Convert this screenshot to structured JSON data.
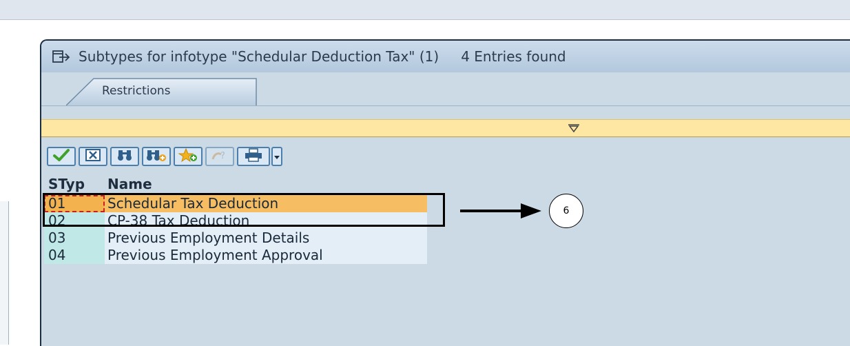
{
  "dialog": {
    "title": "Subtypes for infotype \"Schedular Deduction Tax\" (1)",
    "entries_found": "4 Entries found"
  },
  "tabs": [
    {
      "label": "Restrictions"
    }
  ],
  "toolbar": [
    {
      "icon": "checkmark-icon",
      "state": "enabled"
    },
    {
      "icon": "cancel-x-icon",
      "state": "enabled"
    },
    {
      "icon": "binoculars-icon",
      "state": "enabled"
    },
    {
      "icon": "binoculars-plus-icon",
      "state": "enabled"
    },
    {
      "icon": "star-add-icon",
      "state": "enabled"
    },
    {
      "icon": "help-icon",
      "state": "disabled"
    },
    {
      "icon": "print-icon",
      "state": "enabled"
    },
    {
      "icon": "dropdown-arrow-icon",
      "state": "enabled"
    }
  ],
  "table": {
    "headers": {
      "code": "STyp",
      "name": "Name"
    },
    "rows": [
      {
        "code": "01",
        "name": "Schedular Tax Deduction",
        "selected": true
      },
      {
        "code": "02",
        "name": "CP-38 Tax Deduction"
      },
      {
        "code": "03",
        "name": "Previous Employment Details"
      },
      {
        "code": "04",
        "name": "Previous Employment Approval"
      }
    ]
  },
  "annotation": {
    "step": "6"
  },
  "colors": {
    "dialog_bg": "#ccdae6",
    "selected_row": "#f6bd62",
    "code_column": "#bfe8e6",
    "yellow_bar": "#fde7a3"
  }
}
